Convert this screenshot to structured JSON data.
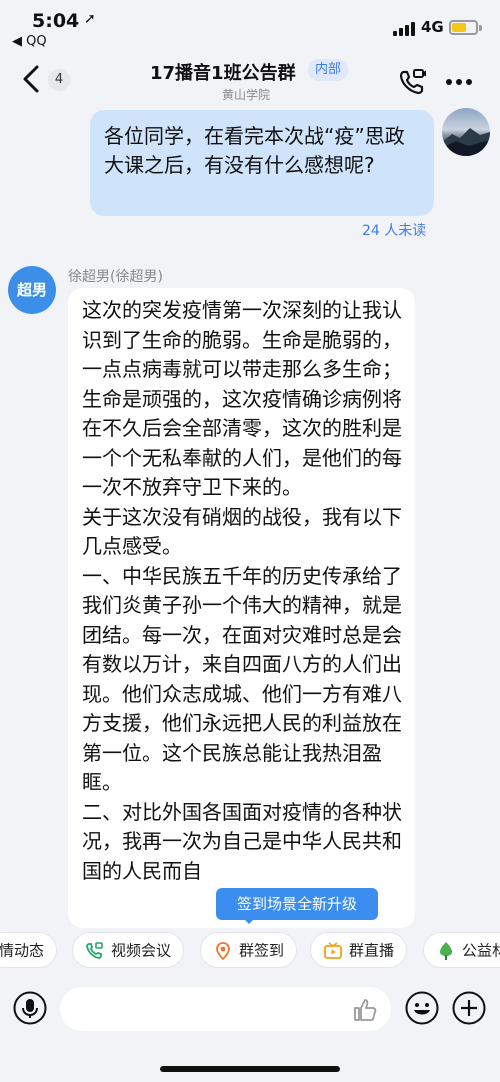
{
  "status_bar": {
    "time": "5:04",
    "location_glyph": "➚",
    "back_to_app": "◀ QQ",
    "network": "4G"
  },
  "header": {
    "unread_count": "4",
    "title": "17播音1班公告群",
    "badge": "内部",
    "subtitle": "黄山学院"
  },
  "my_message": {
    "text": "各位同学，在看完本次战“疫”思政大课之后，有没有什么感想呢?",
    "read_status": "24 人未读"
  },
  "incoming": {
    "avatar_text": "超男",
    "sender": "徐超男(徐超男)",
    "paragraphs": [
      "这次的突发疫情第一次深刻的让我认识到了生命的脆弱。生命是脆弱的，一点点病毒就可以带走那么多生命；生命是顽强的，这次疫情确诊病例将在不久后会全部清零，这次的胜利是一个个无私奉献的人们，是他们的每一次不放弃守卫下来的。",
      "关于这次没有硝烟的战役，我有以下几点感受。",
      "一、中华民族五千年的历史传承给了我们炎黄子孙一个伟大的精神，就是团结。每一次，在面对灾难时总是会有数以万计，来自四面八方的人们出现。他们众志成城、他们一方有难八方支援，他们永远把人民的利益放在第一位。这个民族总能让我热泪盈眶。",
      "二、对比外国各国面对疫情的各种状况，我再一次为自己是中华人民共和国的人民而自"
    ]
  },
  "toast": "签到场景全新升级",
  "feature_chips": [
    {
      "label": "情动态",
      "icon": "feed-icon"
    },
    {
      "label": "视频会议",
      "icon": "video-call-icon"
    },
    {
      "label": "群签到",
      "icon": "location-pin-icon"
    },
    {
      "label": "群直播",
      "icon": "live-tv-icon"
    },
    {
      "label": "公益林",
      "icon": "tree-icon"
    }
  ],
  "colors": {
    "accent": "#3b8df0",
    "my_bubble": "#cfe4fb",
    "background": "#f2f3f7"
  }
}
